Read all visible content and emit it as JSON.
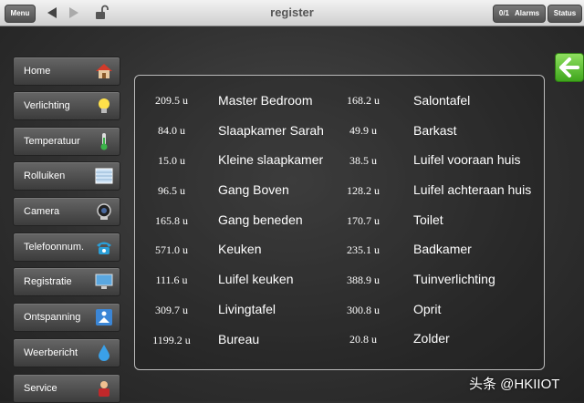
{
  "topbar": {
    "menu_label": "Menu",
    "title": "register",
    "alarms_count": "0/1",
    "alarms_label": "Alarms",
    "status_label": "Status"
  },
  "sidebar": {
    "items": [
      {
        "label": "Home",
        "icon": "house-icon"
      },
      {
        "label": "Verlichting",
        "icon": "lightbulb-icon"
      },
      {
        "label": "Temperatuur",
        "icon": "thermometer-icon"
      },
      {
        "label": "Rolluiken",
        "icon": "window-blind-icon"
      },
      {
        "label": "Camera",
        "icon": "camera-icon"
      },
      {
        "label": "Telefoonnum.",
        "icon": "phone-icon"
      },
      {
        "label": "Registratie",
        "icon": "monitor-icon"
      },
      {
        "label": "Ontspanning",
        "icon": "relax-icon"
      },
      {
        "label": "Weerbericht",
        "icon": "water-drop-icon"
      },
      {
        "label": "Service",
        "icon": "service-icon"
      }
    ]
  },
  "register": {
    "left": [
      {
        "value": "209.5 u",
        "name": "Master Bedroom"
      },
      {
        "value": "84.0 u",
        "name": "Slaapkamer Sarah"
      },
      {
        "value": "15.0 u",
        "name": "Kleine slaapkamer"
      },
      {
        "value": "96.5 u",
        "name": "Gang Boven"
      },
      {
        "value": "165.8 u",
        "name": "Gang beneden"
      },
      {
        "value": "571.0 u",
        "name": "Keuken"
      },
      {
        "value": "111.6 u",
        "name": "Luifel keuken"
      },
      {
        "value": "309.7 u",
        "name": "Livingtafel"
      },
      {
        "value": "1199.2 u",
        "name": "Bureau"
      }
    ],
    "right": [
      {
        "value": "168.2 u",
        "name": "Salontafel"
      },
      {
        "value": "49.9 u",
        "name": "Barkast"
      },
      {
        "value": "38.5 u",
        "name": "Luifel vooraan huis"
      },
      {
        "value": "128.2 u",
        "name": "Luifel achteraan huis"
      },
      {
        "value": "170.7 u",
        "name": "Toilet"
      },
      {
        "value": "235.1 u",
        "name": "Badkamer"
      },
      {
        "value": "388.9 u",
        "name": "Tuinverlichting"
      },
      {
        "value": "300.8 u",
        "name": "Oprit"
      },
      {
        "value": "20.8 u",
        "name": "Zolder"
      }
    ]
  },
  "watermark": "头条 @HKIIOT",
  "colors": {
    "back_button": "#4cb825",
    "panel_border": "#bbbbbb"
  }
}
